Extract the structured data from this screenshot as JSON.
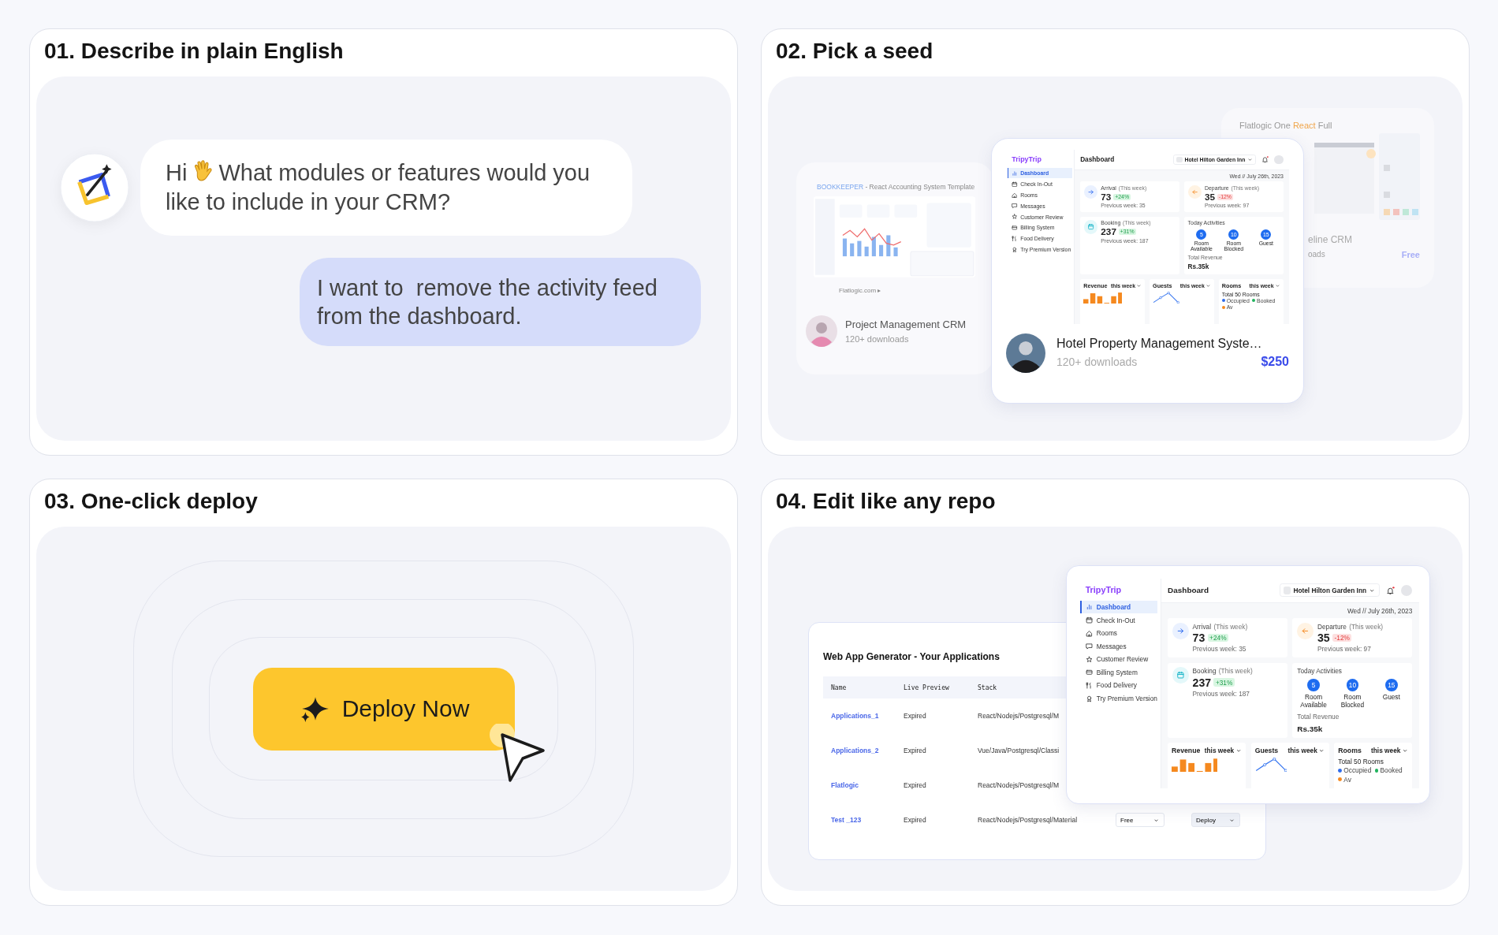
{
  "cards": [
    {
      "kind": "chat",
      "title": "01. Describe in plain English",
      "assistant": {
        "greeting": "Hi",
        "message": "What modules or features would you like to include in your CRM?"
      },
      "user": {
        "message": "I want to  remove the activity feed from the dashboard."
      }
    },
    {
      "kind": "seeds",
      "title": "02. Pick a seed",
      "left_seed": {
        "brand": "BOOKKEEPER",
        "subtitle": " - React Accounting System Template",
        "link": "Flatlogic.com ▸",
        "name": "Project Management CRM",
        "downloads": "120+ downloads"
      },
      "right_seed": {
        "title_start": "Flatlogic One ",
        "title_accent": "React",
        "title_end": " Full",
        "name": "eline CRM",
        "downloads": "oads",
        "price": "Free"
      },
      "featured": {
        "name": "Hotel Property Management Syste…",
        "downloads": "120+ downloads",
        "price": "$250",
        "dashboard": {
          "brand": "TripyTrip",
          "title": "Dashboard",
          "hotel": "Hotel Hilton Garden Inn",
          "date": "Wed // July 26th, 2023",
          "nav": [
            {
              "label": "Dashboard",
              "selected": true
            },
            {
              "label": "Check In-Out",
              "selected": false
            },
            {
              "label": "Rooms",
              "selected": false
            },
            {
              "label": "Messages",
              "selected": false
            },
            {
              "label": "Customer Review",
              "selected": false
            },
            {
              "label": "Billing System",
              "selected": false
            },
            {
              "label": "Food Delivery",
              "selected": false
            },
            {
              "label": "Try Premium Version",
              "selected": false
            }
          ],
          "stats": [
            {
              "kind": "arrival",
              "label": "Arrival",
              "period": "(This week)",
              "value": "73",
              "change": "+24%",
              "rising": true,
              "previous": "Previous week: 35"
            },
            {
              "kind": "departure",
              "label": "Departure",
              "period": "(This week)",
              "value": "35",
              "change": "-12%",
              "rising": false,
              "previous": "Previous week: 97"
            },
            {
              "kind": "booking",
              "label": "Booking",
              "period": "(This week)",
              "value": "237",
              "change": "+31%",
              "rising": true,
              "previous": "Previous week: 187"
            }
          ],
          "activities": {
            "title": "Today Activities",
            "items": [
              {
                "count": "5",
                "label": "Room Available"
              },
              {
                "count": "10",
                "label": "Room Blocked"
              },
              {
                "count": "15",
                "label": "Guest"
              }
            ],
            "revenue_label": "Total Revenue",
            "revenue": "Rs.35k"
          },
          "widgets": [
            {
              "kind": "bars",
              "title": "Revenue",
              "period": "this week"
            },
            {
              "kind": "line",
              "title": "Guests",
              "period": "this week"
            },
            {
              "kind": "rooms",
              "title": "Rooms",
              "period": "this week",
              "total": "Total 50 Rooms",
              "legend": [
                {
                  "label": "Occupied",
                  "color": "#2f6bea"
                },
                {
                  "label": "Booked",
                  "color": "#22b35e"
                },
                {
                  "label": "Av",
                  "color": "#f5891f"
                }
              ]
            }
          ]
        }
      }
    },
    {
      "kind": "deploy",
      "title": "03. One-click deploy",
      "button": "Deploy Now"
    },
    {
      "kind": "repo",
      "title": "04. Edit like any repo",
      "table": {
        "title": "Web App Generator - Your Applications",
        "columns": [
          "Name",
          "Live Preview",
          "Stack"
        ],
        "rows": [
          {
            "name": "Applications_1",
            "preview": "Expired",
            "stack": "React/Nodejs/Postgresql/M"
          },
          {
            "name": "Applications_2",
            "preview": "Expired",
            "stack": "Vue/Java/Postgresql/Classi"
          },
          {
            "name": "Flatlogic",
            "preview": "Expired",
            "stack": "React/Nodejs/Postgresql/M"
          },
          {
            "name": "Test _123",
            "preview": "Expired",
            "stack": "React/Nodejs/Postgresql/Material",
            "plan": "Free",
            "action": "Deploy"
          }
        ]
      },
      "dashboard": {
        "brand": "TripyTrip",
        "title": "Dashboard",
        "hotel": "Hotel Hilton Garden Inn",
        "date": "Wed // July 26th, 2023",
        "nav": [
          {
            "label": "Dashboard",
            "selected": true
          },
          {
            "label": "Check In-Out",
            "selected": false
          },
          {
            "label": "Rooms",
            "selected": false
          },
          {
            "label": "Messages",
            "selected": false
          },
          {
            "label": "Customer Review",
            "selected": false
          },
          {
            "label": "Billing System",
            "selected": false
          },
          {
            "label": "Food Delivery",
            "selected": false
          },
          {
            "label": "Try Premium Version",
            "selected": false
          }
        ],
        "stats": [
          {
            "kind": "arrival",
            "label": "Arrival",
            "period": "(This week)",
            "value": "73",
            "change": "+24%",
            "rising": true,
            "previous": "Previous week: 35"
          },
          {
            "kind": "departure",
            "label": "Departure",
            "period": "(This week)",
            "value": "35",
            "change": "-12%",
            "rising": false,
            "previous": "Previous week: 97"
          },
          {
            "kind": "booking",
            "label": "Booking",
            "period": "(This week)",
            "value": "237",
            "change": "+31%",
            "rising": true,
            "previous": "Previous week: 187"
          }
        ],
        "activities": {
          "title": "Today Activities",
          "items": [
            {
              "count": "5",
              "label": "Room Available"
            },
            {
              "count": "10",
              "label": "Room Blocked"
            },
            {
              "count": "15",
              "label": "Guest"
            }
          ],
          "revenue_label": "Total Revenue",
          "revenue": "Rs.35k"
        },
        "widgets": [
          {
            "kind": "bars",
            "title": "Revenue",
            "period": "this week"
          },
          {
            "kind": "line",
            "title": "Guests",
            "period": "this week"
          },
          {
            "kind": "rooms",
            "title": "Rooms",
            "period": "this week",
            "total": "Total 50 Rooms",
            "legend": [
              {
                "label": "Occupied",
                "color": "#2f6bea"
              },
              {
                "label": "Booked",
                "color": "#22b35e"
              },
              {
                "label": "Av",
                "color": "#f5891f"
              }
            ]
          }
        ]
      }
    }
  ]
}
